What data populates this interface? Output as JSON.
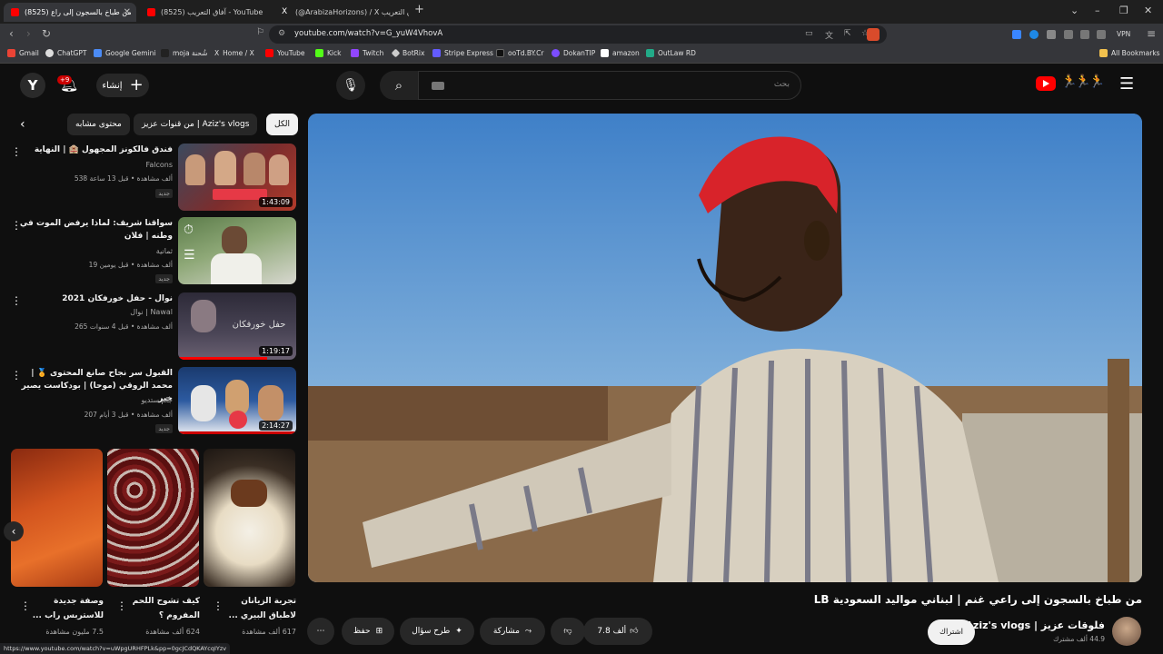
{
  "browser": {
    "tabs": [
      {
        "title": "(8525) من طباخ بالسجون إلى راع",
        "active": true
      },
      {
        "title": "(8525) آفاق التعريب - YouTube",
        "active": false
      },
      {
        "title": "(@ArabizaHorizons) / X آفاق التعريب",
        "active": false
      }
    ],
    "new_tab": "+",
    "url": "youtube.com/watch?v=G_yuW4VhovA",
    "vpn_label": "VPN",
    "bookmarks": [
      "Gmail",
      "ChatGPT",
      "Google Gemini",
      "moja شُحنة",
      "Home / X",
      "YouTube",
      "Kick",
      "Twitch",
      "BotRix",
      "Stripe Express",
      "ooTd.BY.Cr",
      "DokanTIP",
      "amazon",
      "OutLaw RD"
    ],
    "all_bookmarks": "All Bookmarks",
    "status_url": "https://www.youtube.com/watch?v=uWpgURHFPLk&pp=0gcJCdQKAYcqIYzv"
  },
  "header": {
    "avatar_letter": "Y",
    "notif_badge": "+9",
    "create_label": "إنشاء",
    "search_placeholder": "بحث"
  },
  "chips": [
    "الكل",
    "من قنوات عزيز | Aziz's vlogs",
    "محتوى مشابه"
  ],
  "recommendations": [
    {
      "title": "فندق فالكونز المجهول 🏨 | النهاية",
      "channel": "Falcons",
      "meta": "538 ألف مشاهدة • قبل 13 ساعة",
      "badge": "جديد",
      "duration": "1:43:09"
    },
    {
      "title": "سواقنا شريف: لماذا يرفض الموت في وطنه | فلان",
      "channel": "ثمانية",
      "meta": "19 ألف مشاهدة • قبل يومين",
      "badge": "جديد",
      "duration": ""
    },
    {
      "title": "نوال - حفل خورفكان 2021",
      "channel": "نوال | Nawal",
      "meta": "265 ألف مشاهدة • قبل 4 سنوات",
      "badge": "",
      "duration": "1:19:17"
    },
    {
      "title": "القبول سر نجاح صانع المحتوى 🏅 | محمد الروقي (موحا) | بودكاست يصير خير",
      "channel": "جام ستديو",
      "meta": "207 ألف مشاهدة • قبل 3 أيام",
      "badge": "جديد",
      "duration": "2:14:27"
    }
  ],
  "shorts": [
    {
      "title": "تجربة الزيانان لاطباق البيري ...",
      "views": "617 ألف مشاهدة"
    },
    {
      "title": "كيف تشوح اللحم المفروم ؟",
      "views": "624 ألف مشاهدة"
    },
    {
      "title": "وصفة جديدة للاستربس راب ...",
      "views": "7.5 مليون مشاهدة"
    }
  ],
  "video": {
    "title": "من طباخ بالسجون إلى راعي غنم | لبناني مواليد السعودية LB",
    "channel": "فلوقات عزيز | Aziz's vlogs",
    "subscribers": "44.9 ألف مشترك",
    "subscribe_label": "اشتراك",
    "likes": "7.8 ألف",
    "share_label": "مشاركة",
    "ask_label": "طرح سؤال",
    "save_label": "حفظ"
  }
}
